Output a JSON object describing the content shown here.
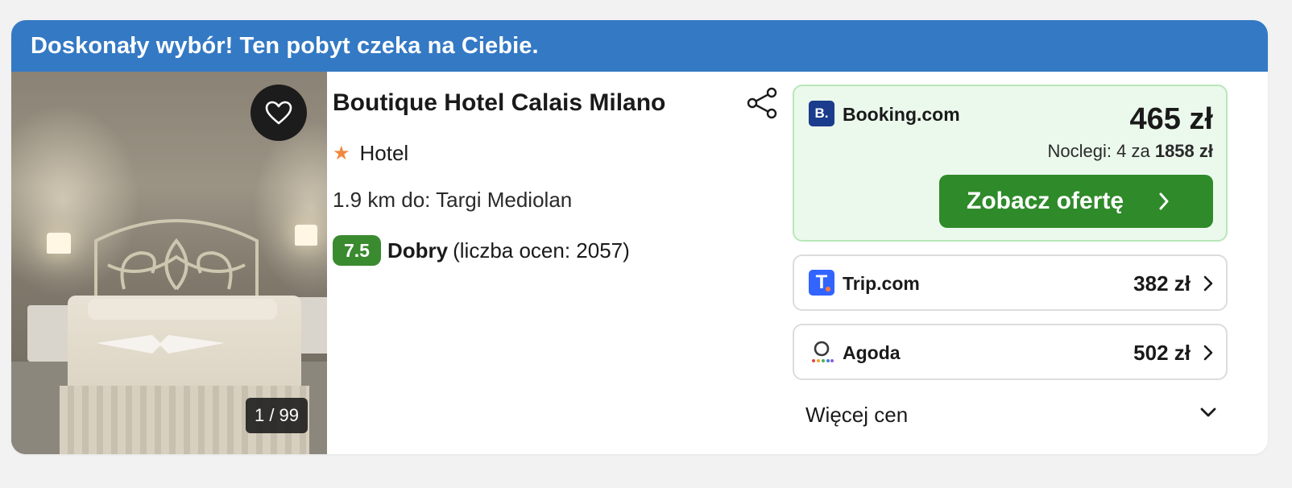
{
  "banner": {
    "text": "Doskonały wybór! Ten pobyt czeka na Ciebie."
  },
  "gallery": {
    "counter": "1 / 99"
  },
  "hotel": {
    "name": "Boutique Hotel Calais Milano",
    "type": "Hotel",
    "stars": 1,
    "distance": "1.9 km do: Targi Mediolan",
    "rating": {
      "score": "7.5",
      "word": "Dobry",
      "count_text": "(liczba ocen: 2057)"
    }
  },
  "offers": {
    "main": {
      "provider": "Booking.com",
      "logo_letter": "B.",
      "price": "465 zł",
      "nights_prefix": "Noclegi: 4 za",
      "nights_total": "1858 zł",
      "cta": "Zobacz ofertę"
    },
    "others": [
      {
        "provider": "Trip.com",
        "logo_letter": "T",
        "price": "382 zł"
      },
      {
        "provider": "Agoda",
        "logo_letter": "",
        "price": "502 zł"
      }
    ],
    "more_label": "Więcej cen"
  },
  "colors": {
    "banner": "#3479c4",
    "score": "#3a8a2f",
    "cta": "#2f8a2a",
    "deal_highlight_bg": "#ebf9ec",
    "booking_logo": "#1b3c8c",
    "trip_logo": "#3264ff",
    "star": "#f0883e"
  },
  "icons": {
    "favorite": "heart-icon",
    "share": "share-icon",
    "star": "star-icon",
    "chevron": "chevron-right-icon",
    "expand": "chevron-down-icon"
  }
}
